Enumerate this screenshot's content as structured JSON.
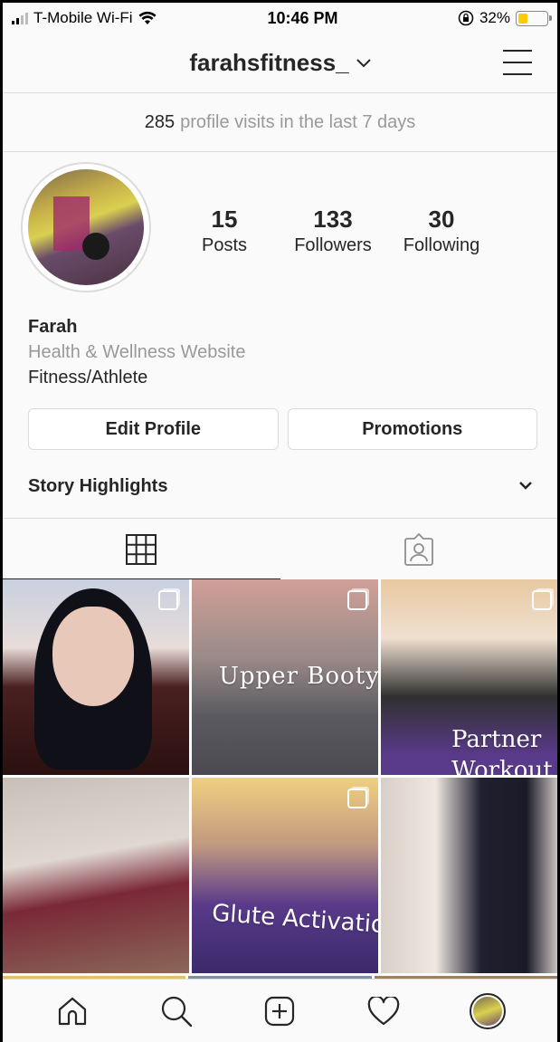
{
  "status_bar": {
    "carrier": "T-Mobile Wi-Fi",
    "time": "10:46 PM",
    "battery_percent": "32%",
    "battery_level": 0.32
  },
  "header": {
    "username": "farahsfitness_",
    "chevron": "⌄"
  },
  "insights": {
    "count": "285",
    "text": "profile visits in the last 7 days"
  },
  "profile": {
    "stats": [
      {
        "num": "15",
        "label": "Posts"
      },
      {
        "num": "133",
        "label": "Followers"
      },
      {
        "num": "30",
        "label": "Following"
      }
    ],
    "name": "Farah",
    "category": "Health & Wellness Website",
    "bio": "Fitness/Athlete"
  },
  "buttons": {
    "edit_profile": "Edit Profile",
    "promotions": "Promotions"
  },
  "highlights": {
    "label": "Story Highlights",
    "chevron": "⌄"
  },
  "posts": [
    {
      "caption": ""
    },
    {
      "caption": "Upper Booty"
    },
    {
      "caption": "Partner Workout"
    },
    {
      "caption": ""
    },
    {
      "caption": "Glute Activation"
    },
    {
      "caption": ""
    }
  ],
  "icons": {
    "grid": "grid-icon",
    "tagged": "tagged-icon",
    "home": "home-icon",
    "search": "search-icon",
    "add": "add-post-icon",
    "activity": "heart-icon"
  },
  "colors": {
    "text": "#262626",
    "muted": "#999999",
    "border": "#dbdbdb",
    "battery": "#ffcc00"
  }
}
